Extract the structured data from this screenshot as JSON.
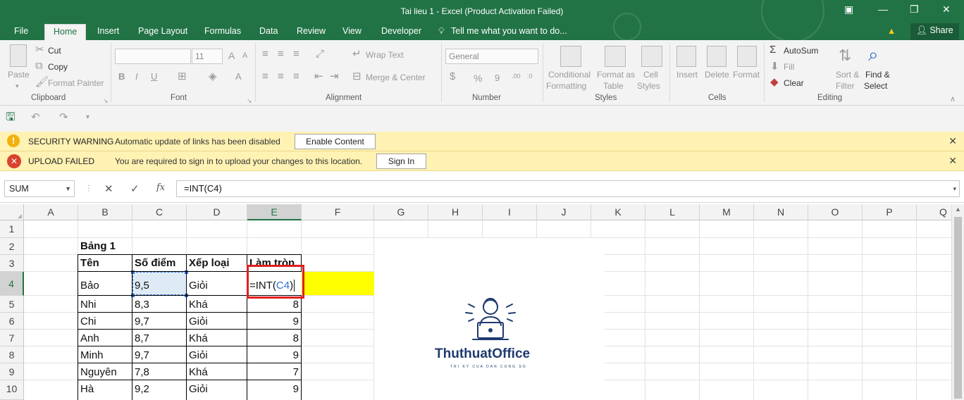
{
  "window": {
    "title": "Tai lieu 1 - Excel (Product Activation Failed)",
    "minimize": "—",
    "restore": "❐",
    "close": "✕",
    "ribbon_opts": "▣"
  },
  "tabs": [
    "File",
    "Home",
    "Insert",
    "Page Layout",
    "Formulas",
    "Data",
    "Review",
    "View",
    "Developer"
  ],
  "tell_me": "Tell me what you want to do...",
  "share": "Share",
  "ribbon": {
    "clipboard": {
      "label": "Clipboard",
      "paste": "Paste",
      "cut": "Cut",
      "copy": "Copy",
      "format_painter": "Format Painter"
    },
    "font": {
      "label": "Font",
      "size": "11",
      "bold": "B",
      "italic": "I",
      "underline": "U",
      "grow": "A",
      "shrink": "A"
    },
    "alignment": {
      "label": "Alignment",
      "wrap_text": "Wrap Text",
      "merge_center": "Merge & Center"
    },
    "number": {
      "label": "Number",
      "format": "General",
      "percent": "%",
      "comma": "9",
      "inc": ".00",
      "dec": ".0"
    },
    "styles": {
      "label": "Styles",
      "conditional1": "Conditional",
      "conditional2": "Formatting",
      "format_as1": "Format as",
      "format_as2": "Table",
      "cell_styles1": "Cell",
      "cell_styles2": "Styles"
    },
    "cells": {
      "label": "Cells",
      "insert": "Insert",
      "delete": "Delete",
      "format": "Format"
    },
    "editing": {
      "label": "Editing",
      "autosum": "AutoSum",
      "fill": "Fill",
      "clear": "Clear",
      "sort1": "Sort &",
      "sort2": "Filter",
      "find1": "Find &",
      "find2": "Select"
    }
  },
  "messages": {
    "security": {
      "title": "SECURITY WARNING",
      "text": "Automatic update of links has been disabled",
      "button": "Enable Content"
    },
    "upload": {
      "title": "UPLOAD FAILED",
      "text": "You are required to sign in to upload your changes to this location.",
      "button": "Sign In"
    }
  },
  "formula_bar": {
    "name_box": "SUM",
    "cancel": "✕",
    "enter": "✓",
    "fx": "fx",
    "formula": "=INT(C4)"
  },
  "columns": [
    "A",
    "B",
    "C",
    "D",
    "E",
    "F",
    "G",
    "H",
    "I",
    "J",
    "K",
    "L",
    "M",
    "N",
    "O",
    "P",
    "Q"
  ],
  "rows": [
    "1",
    "2",
    "3",
    "4",
    "5",
    "6",
    "7",
    "8",
    "9",
    "10"
  ],
  "sheet": {
    "table_title": "Bảng 1",
    "headers": [
      "Tên",
      "Số điểm",
      "Xếp loại",
      "Làm tròn"
    ],
    "editing_formula_prefix": "=INT(",
    "editing_formula_ref": "C4",
    "editing_formula_suffix": ")",
    "data": [
      {
        "name": "Bảo",
        "score": "9,5",
        "rank": "Giỏi",
        "round": ""
      },
      {
        "name": "Nhi",
        "score": "8,3",
        "rank": "Khá",
        "round": "8"
      },
      {
        "name": "Chi",
        "score": "9,7",
        "rank": "Giỏi",
        "round": "9"
      },
      {
        "name": "Anh",
        "score": "8,7",
        "rank": "Khá",
        "round": "8"
      },
      {
        "name": "Minh",
        "score": "9,7",
        "rank": "Giỏi",
        "round": "9"
      },
      {
        "name": "Nguyên",
        "score": "7,8",
        "rank": "Khá",
        "round": "7"
      },
      {
        "name": "Hà",
        "score": "9,2",
        "rank": "Giỏi",
        "round": "9"
      }
    ]
  },
  "logo": {
    "brand": "ThuthuatOffice",
    "tagline": "TRI KY CUA DAN CONG SO"
  },
  "colors": {
    "excel_green": "#217346",
    "highlight_yellow": "#ffff00",
    "ref_blue": "#2e6fd1",
    "annotation_red": "#e02020"
  }
}
